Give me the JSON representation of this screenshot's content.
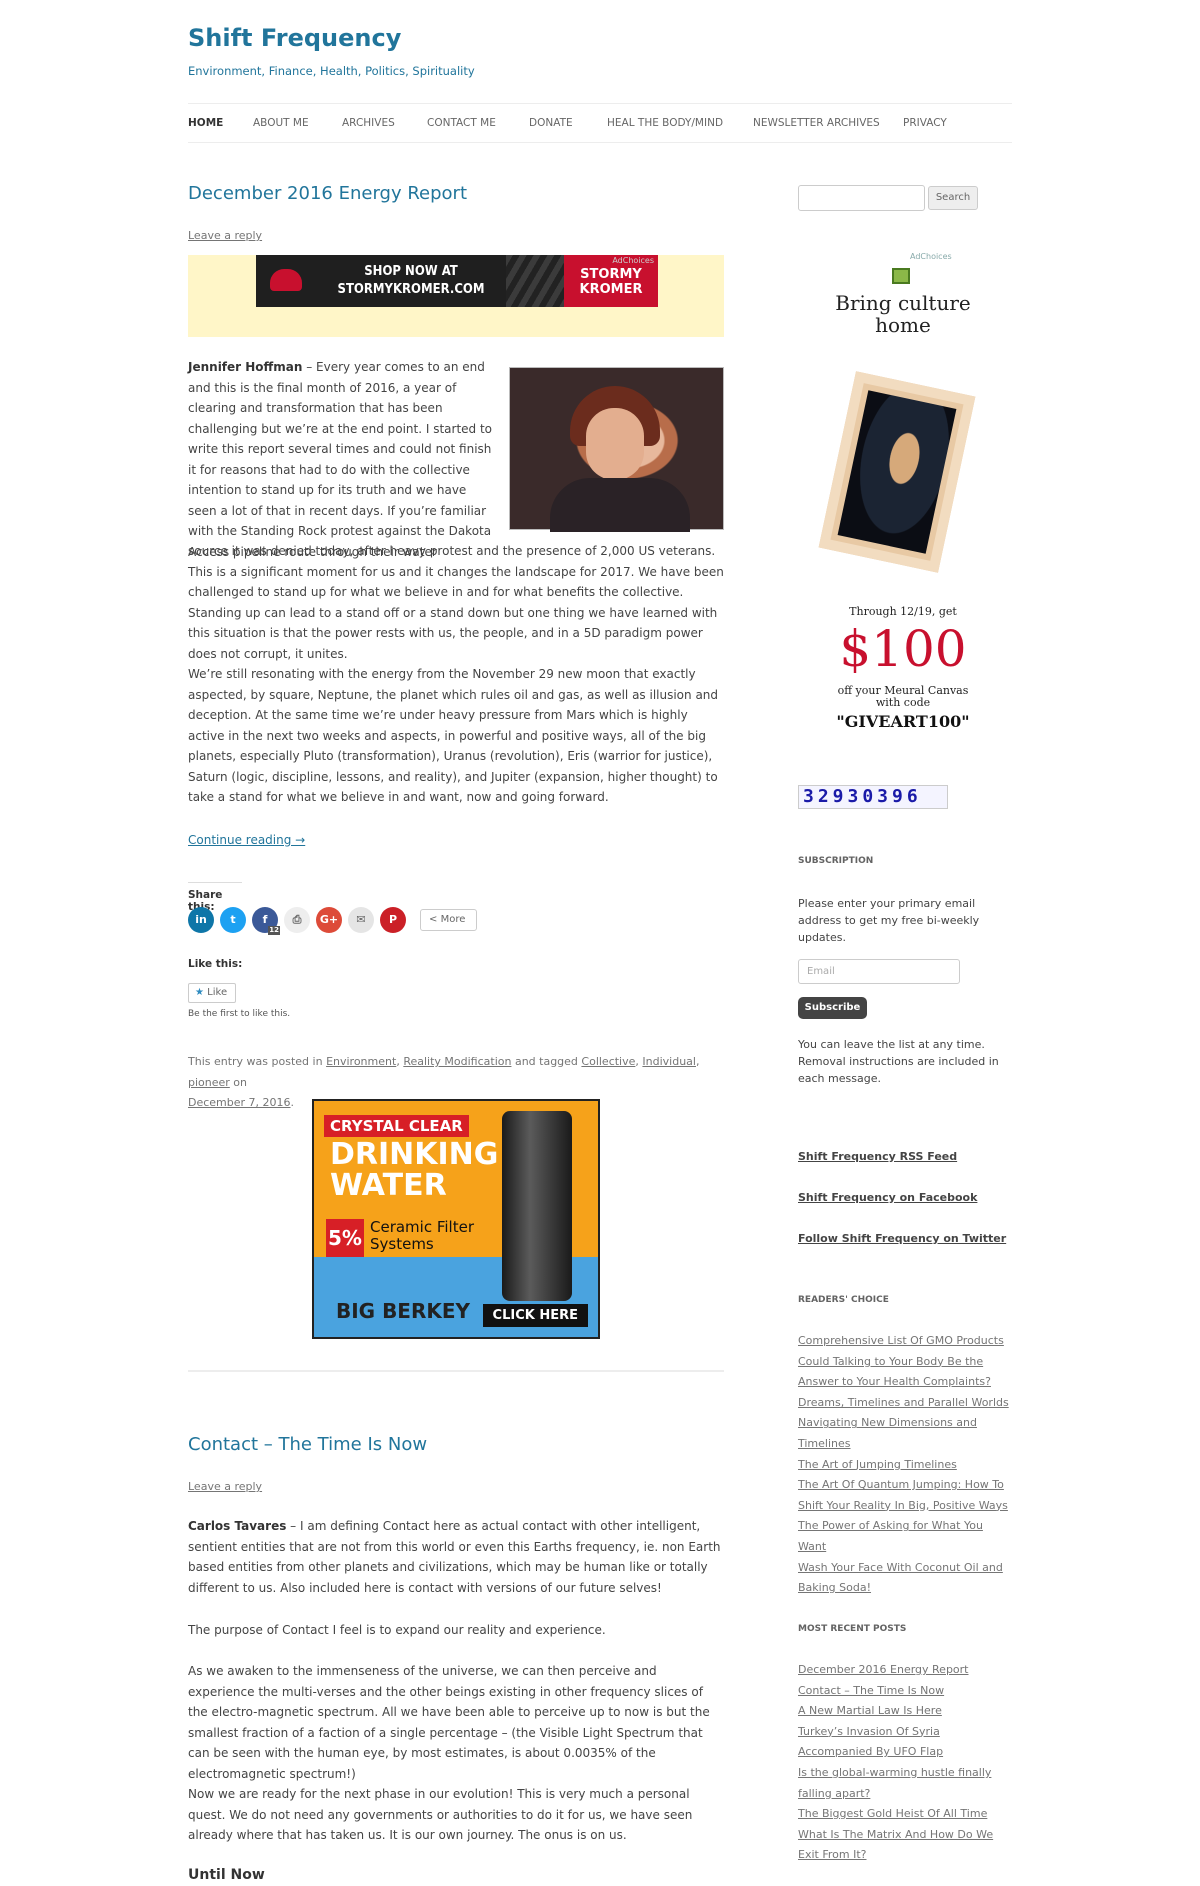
{
  "site": {
    "title": "Shift Frequency",
    "description": "Environment, Finance, Health, Politics, Spirituality"
  },
  "nav": {
    "items": [
      "HOME",
      "ABOUT ME",
      "ARCHIVES",
      "CONTACT ME",
      "DONATE",
      "HEAL THE BODY/MIND",
      "NEWSLETTER ARCHIVES",
      "PRIVACY"
    ]
  },
  "post1": {
    "title": "December 2016 Energy Report",
    "reply": "Leave a reply",
    "ad": {
      "shop": "SHOP NOW AT STORMYKROMER.COM",
      "brand": "STORMY KROMER",
      "adchoices": "AdChoices"
    },
    "author": "Jennifer Hoffman",
    "para1a": " – Every year comes to an end and this is the final month of 2016, a year of clearing and transformation that has been challenging but we’re at the end point. I started to write this report several times and could not finish it for reasons that had to do with the collective intention to stand up for its truth and we have seen a lot of that in recent days. If you’re familiar with the Standing Rock protest against the Dakota Access pipeline route through their water",
    "para1b": "source it was denied today, after heavy protest and the presence of 2,000 US veterans. This is a significant moment for us and it changes the landscape for 2017. We have been challenged to stand up for what we believe in and for what benefits the collective. Standing up can lead to a stand off or a stand down but one thing we have learned with this situation is that the power rests with us, the people, and in a 5D paradigm power does not corrupt, it unites.",
    "para2": "We’re still resonating with the energy from the November 29 new moon that exactly aspected, by square, Neptune, the planet which rules oil and gas, as well as illusion and deception. At the same time we’re under heavy pressure from Mars which is highly active in the next two weeks and aspects, in powerful and positive ways, all of the big planets, especially Pluto (transformation), Uranus (revolution), Eris (warrior for justice), Saturn (logic, discipline, lessons, and reality), and Jupiter (expansion, higher thought) to take a stand for what we believe in and want, now and going forward.",
    "continue": "Continue reading →",
    "share_label": "Share this:",
    "share_more": "More",
    "share_fb_count": "12",
    "like_label": "Like this:",
    "like_btn": "Like",
    "first_like": "Be the first to like this.",
    "meta": {
      "prefix": "This entry was posted in ",
      "cat1": "Environment",
      "sep1": ", ",
      "cat2": "Reality Modification",
      "mid": " and tagged ",
      "tag1": "Collective",
      "sep2": ", ",
      "tag2": "Individual",
      "sep3": ", ",
      "tag3": "pioneer",
      "on": " on ",
      "date": "December 7, 2016",
      "end": "."
    }
  },
  "berkey_ad": {
    "line1": "CRYSTAL CLEAR",
    "line2": "DRINKING",
    "line3": "WATER",
    "pct": "5%",
    "ceramic": "Ceramic Filter Systems",
    "logo": "BIG BERKEY",
    "cta": "CLICK HERE"
  },
  "post2": {
    "title": "Contact – The Time Is Now",
    "reply": "Leave a reply",
    "author": "Carlos Tavares",
    "para1": " – I am defining Contact here as actual contact with other intelligent, sentient entities that are not from this world or even this Earths frequency, ie. non Earth based entities from other planets and civilizations, which may be human like or totally different to us. Also included here is contact with versions of our future selves!",
    "para2": "The purpose of Contact I feel is to expand our reality and experience.",
    "para3": "As we awaken to the immenseness of the universe, we can then perceive and experience the multi-verses and the other beings existing in other frequency slices of the electro-magnetic spectrum. All we have been able to perceive up to now is but the smallest fraction of a faction of a single percentage – (the Visible Light Spectrum that can be seen with the human eye, by most estimates, is about 0.0035% of the electromagnetic spectrum!)",
    "para4": "Now we are ready for the next phase in our evolution! This is very much a personal quest. We do not need any governments or authorities to do it for us, we have seen already where that has taken us. It is our own journey. The onus is on us.",
    "h3": "Until Now"
  },
  "sidebar": {
    "search_btn": "Search",
    "art_ad": {
      "adchoices": "AdChoices",
      "bring": "Bring culture home",
      "through": "Through 12/19, get",
      "price": "$100",
      "off": "off your Meural Canvas with code",
      "code": "\"GIVEART100\""
    },
    "counter": "32930396",
    "subscription_title": "SUBSCRIPTION",
    "subscription_desc": "Please enter your primary email address to get my free bi-weekly updates.",
    "email_placeholder": "Email",
    "subscribe_btn": "Subscribe",
    "leave_desc": "You can leave the list at any time. Removal instructions are included in each message.",
    "links": [
      "Shift Frequency RSS Feed",
      "Shift Frequency on Facebook",
      "Follow Shift Frequency on Twitter"
    ],
    "readers_title": "READERS' CHOICE",
    "readers": [
      "Comprehensive List Of GMO Products",
      "Could Talking to Your Body Be the Answer to Your Health Complaints?",
      "Dreams, Timelines and Parallel Worlds",
      "Navigating New Dimensions and Timelines",
      "The Art of Jumping Timelines",
      "The Art Of Quantum Jumping: How To Shift Your Reality In Big, Positive Ways",
      "The Power of Asking for What You Want",
      "Wash Your Face With Coconut Oil and Baking Soda!"
    ],
    "recent_title": "MOST RECENT POSTS",
    "recent": [
      "December 2016 Energy Report",
      "Contact – The Time Is Now",
      "A New Martial Law Is Here",
      "Turkey’s Invasion Of Syria Accompanied By UFO Flap",
      "Is the global-warming hustle finally falling apart?",
      "The Biggest Gold Heist Of All Time",
      "What Is The Matrix And How Do We Exit From It?"
    ]
  }
}
